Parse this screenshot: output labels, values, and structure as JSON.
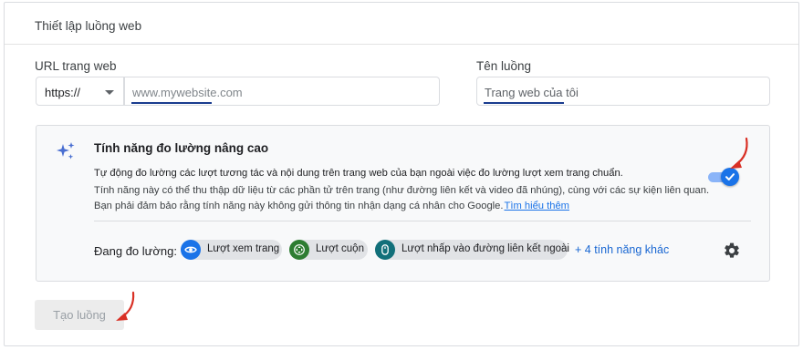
{
  "card": {
    "title": "Thiết lập luồng web"
  },
  "url_section": {
    "label": "URL trang web",
    "protocol": "https://",
    "placeholder": "www.mywebsite.com"
  },
  "stream_name": {
    "label": "Tên luồng",
    "placeholder": "Trang web của tôi"
  },
  "enhanced": {
    "title": "Tính năng đo lường nâng cao",
    "line1": "Tự động đo lường các lượt tương tác và nội dung trên trang web của bạn ngoài việc đo lường lượt xem trang chuẩn.",
    "desc": "Tính năng này có thể thu thập dữ liệu từ các phần tử trên trang (như đường liên kết và video đã nhúng), cùng với các sự kiện liên quan. Bạn phải đảm bảo rằng tính năng này không gửi thông tin nhận dạng cá nhân cho Google.",
    "link": "Tìm hiểu thêm",
    "toggle_on": true,
    "measuring_label": "Đang đo lường:",
    "chips": [
      {
        "label": "Lượt xem trang",
        "icon": "eye-icon",
        "color": "#1a73e8"
      },
      {
        "label": "Lượt cuộn",
        "icon": "scroll-icon",
        "color": "#1e8e3e"
      },
      {
        "label": "Lượt nhấp vào đường liên kết ngoài",
        "icon": "mouse-icon",
        "color": "#12707a"
      }
    ],
    "more": "+ 4 tính năng khác"
  },
  "create_button": {
    "label": "Tạo luồng"
  },
  "colors": {
    "accent": "#1a73e8",
    "annotation_arrow": "#d93025"
  }
}
